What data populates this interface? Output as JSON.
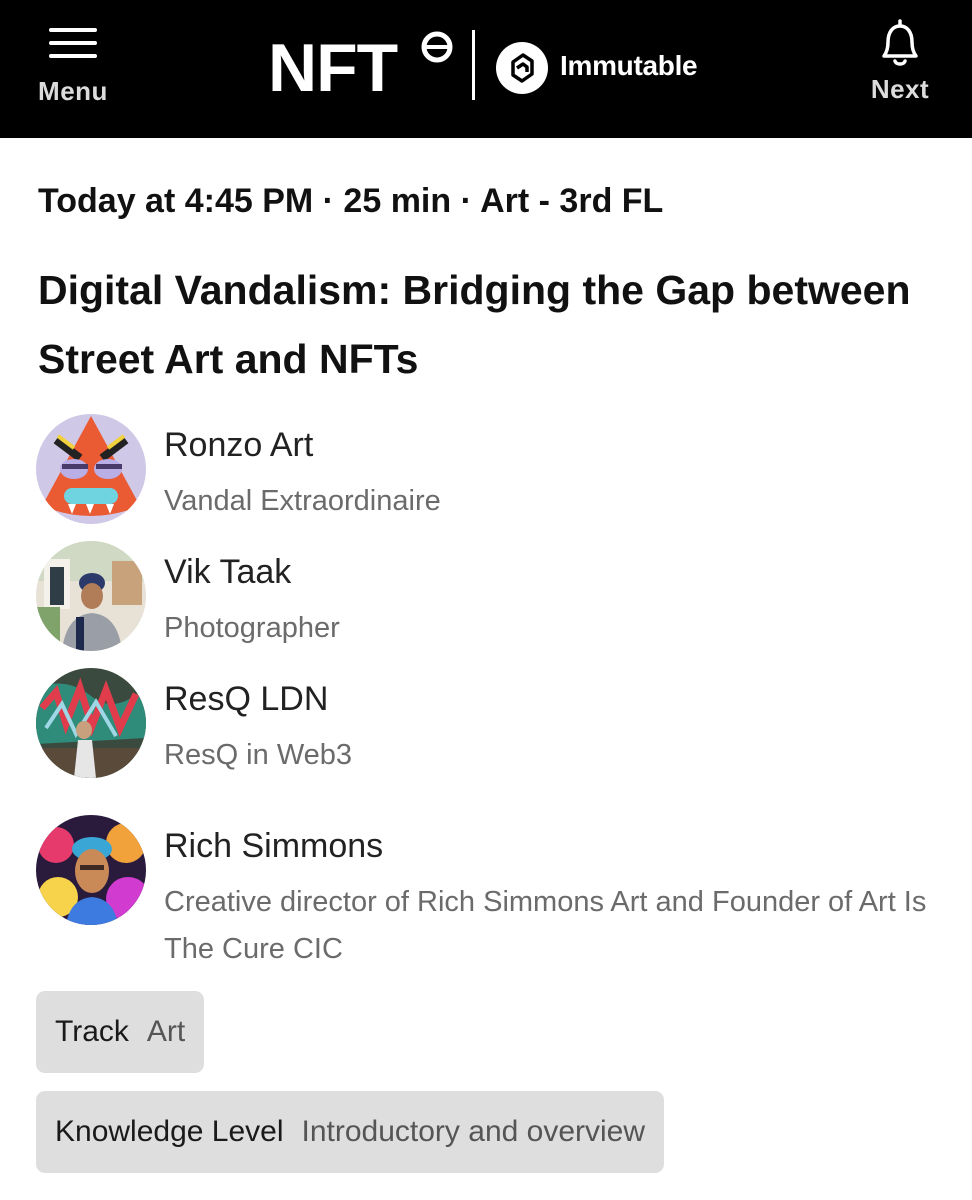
{
  "header": {
    "menu_label": "Menu",
    "next_label": "Next",
    "logo_text": "NFT",
    "partner_logo_text": "Immutable",
    "icons": [
      "menu-icon",
      "nft-ring-icon",
      "immutable-logo-icon",
      "bell-icon"
    ],
    "background": "#000000"
  },
  "session": {
    "meta": "Today at 4:45 PM · 25 min · Art - 3rd FL",
    "title": "Digital Vandalism: Bridging the Gap between Street Art and NFTs"
  },
  "speakers": [
    {
      "name": "Ronzo Art",
      "role": "Vandal Extraordinaire"
    },
    {
      "name": "Vik Taak",
      "role": "Photographer"
    },
    {
      "name": "ResQ LDN",
      "role": "ResQ in Web3"
    },
    {
      "name": "Rich Simmons",
      "role": "Creative director of Rich Simmons Art and Founder of Art Is The Cure CIC"
    }
  ],
  "tags": [
    {
      "key": "Track",
      "value": "Art"
    },
    {
      "key": "Knowledge Level",
      "value": "Introductory and overview"
    }
  ],
  "colors": {
    "chip_background": "#dedede",
    "secondary_text": "#6b6b6b"
  }
}
